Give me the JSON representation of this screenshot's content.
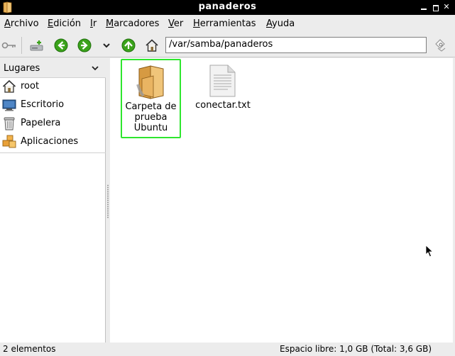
{
  "window": {
    "title": "panaderos"
  },
  "menubar": {
    "items": [
      {
        "mnemonic": "A",
        "rest": "rchivo"
      },
      {
        "mnemonic": "E",
        "rest": "dición"
      },
      {
        "mnemonic": "I",
        "rest": "r"
      },
      {
        "mnemonic": "M",
        "rest": "arcadores"
      },
      {
        "mnemonic": "V",
        "rest": "er"
      },
      {
        "mnemonic": "H",
        "rest": "erramientas"
      },
      {
        "mnemonic": "A",
        "rest": "yuda"
      }
    ]
  },
  "toolbar": {
    "location_value": "/var/samba/panaderos"
  },
  "sidebar": {
    "header": "Lugares",
    "places": [
      {
        "label": "root",
        "icon": "home-icon"
      },
      {
        "label": "Escritorio",
        "icon": "desktop-icon"
      },
      {
        "label": "Papelera",
        "icon": "trash-icon"
      },
      {
        "label": "Aplicaciones",
        "icon": "applications-icon"
      }
    ]
  },
  "files": [
    {
      "name": "Carpeta de prueba Ubuntu",
      "icon": "folder-icon",
      "selected": true
    },
    {
      "name": "conectar.txt",
      "icon": "text-file-icon",
      "selected": false
    }
  ],
  "status": {
    "items_count": "2 elementos",
    "free_space": "Espacio libre: 1,0 GB (Total: 3,6 GB)"
  },
  "colors": {
    "title_bar": "#000000",
    "selection_border": "#2ee62e",
    "nav_arrow_green": "#3aa21a"
  }
}
